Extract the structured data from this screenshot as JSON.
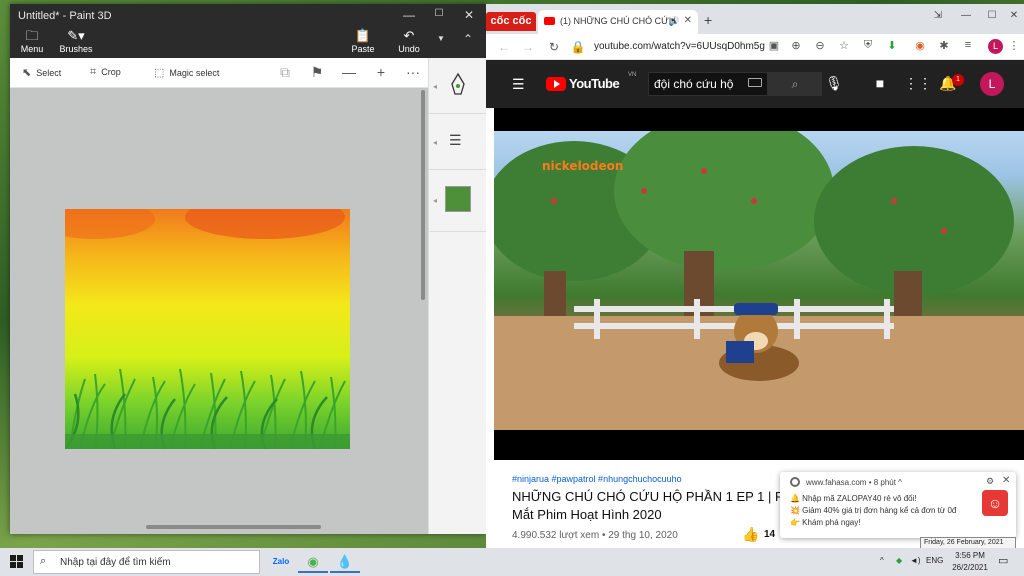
{
  "paint": {
    "title": "Untitled* - Paint 3D",
    "controls": {
      "minimize": "—",
      "maximize": "☐",
      "close": "✕"
    },
    "tools": {
      "menu": "Menu",
      "brushes": "Brushes",
      "paste": "Paste",
      "undo": "Undo"
    },
    "bar": {
      "select": "Select",
      "crop": "Crop",
      "magic_select": "Magic select",
      "zoom_out": "—",
      "zoom_in": "+",
      "more": "···"
    },
    "side_color": "#4e8f3a"
  },
  "browser": {
    "brand": "cốc cốc",
    "tab_title": "(1) NHỮNG CHÚ CHÓ CỨU",
    "new_tab": "+",
    "url": "youtube.com/watch?v=6UUsqD0hm5g",
    "profile_letter": "L"
  },
  "youtube": {
    "logo": "YouTube",
    "country": "VN",
    "search_value": "đội chó cứu hộ",
    "notif_count": "1",
    "avatar_letter": "L",
    "channel_logo": "nickelodeon",
    "hashtags": "#ninjarua #pawpatrol #nhungchuchocuuho",
    "title": "NHỮNG CHÚ CHÓ CỨU HỘ PHẦN 1 EP 1 | Ra Mắt Phim Hoạt Hình 2020",
    "meta": "4.990.532 lượt xem • 29 thg 10, 2020",
    "likes": "14"
  },
  "notification": {
    "source": "www.fahasa.com • 8 phút ^",
    "line1": "🔔 Nhập mã ZALOPAY40 rẻ vô đối!",
    "line2": "💥 Giảm 40% giá trị đơn hàng kể cả đơn từ 0đ",
    "line3": "👉 Khám phá ngay!"
  },
  "tooltip": "Friday, 26 February, 2021",
  "taskbar": {
    "search_placeholder": "Nhập tại đây để tìm kiếm",
    "lang": "ENG",
    "time": "3:56 PM",
    "date": "26/2/2021"
  }
}
